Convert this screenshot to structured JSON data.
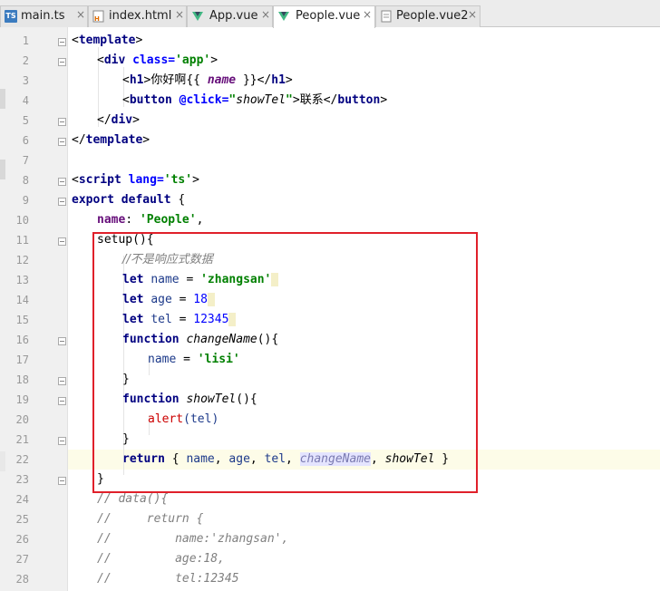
{
  "tabs": [
    {
      "name": "main.ts",
      "icon": "typescript-file-icon",
      "active": false
    },
    {
      "name": "index.html",
      "icon": "html-file-icon",
      "active": false
    },
    {
      "name": "App.vue",
      "icon": "vue-file-icon",
      "active": false
    },
    {
      "name": "People.vue",
      "icon": "vue-file-icon",
      "active": true
    },
    {
      "name": "People.vue2",
      "icon": "text-file-icon",
      "active": false
    }
  ],
  "tab_close_glyph": "×",
  "line_numbers": [
    "1",
    "2",
    "3",
    "4",
    "5",
    "6",
    "7",
    "8",
    "9",
    "10",
    "11",
    "12",
    "13",
    "14",
    "15",
    "16",
    "17",
    "18",
    "19",
    "20",
    "21",
    "22",
    "23",
    "24",
    "25",
    "26",
    "27",
    "28"
  ],
  "code": {
    "l1": {
      "tag": "template"
    },
    "l2": {
      "tag": "div",
      "attr": "class",
      "val": "'app'"
    },
    "l3": {
      "tag": "h1",
      "text_cn": "你好啊",
      "interp": "name"
    },
    "l4": {
      "tag": "button",
      "event": "@click",
      "handler": "showTel",
      "label_cn": "联系"
    },
    "l5": {
      "tag": "div"
    },
    "l6": {
      "tag": "template"
    },
    "l8": {
      "tag": "script",
      "attr": "lang",
      "val": "'ts'"
    },
    "l9": {
      "kw1": "export",
      "kw2": "default",
      "brace": "{"
    },
    "l10": {
      "key": "name",
      "val": "'People'"
    },
    "l11": {
      "text": "setup(){"
    },
    "l12": {
      "comment": "//不是响应式数据"
    },
    "l13": {
      "kw": "let",
      "var": "name",
      "val": "'zhangsan'"
    },
    "l14": {
      "kw": "let",
      "var": "age",
      "val": "18"
    },
    "l15": {
      "kw": "let",
      "var": "tel",
      "val": "12345"
    },
    "l16": {
      "kw": "function",
      "fn": "changeName",
      "tail": "(){"
    },
    "l17": {
      "var": "name",
      "val": "'lisi'"
    },
    "l18": {
      "text": "}"
    },
    "l19": {
      "kw": "function",
      "fn": "showTel",
      "tail": "(){"
    },
    "l20": {
      "fn": "alert",
      "arg": "(tel)"
    },
    "l21": {
      "text": "}"
    },
    "l22": {
      "kw": "return",
      "items": [
        "name",
        "age",
        "tel",
        "changeName",
        "showTel"
      ]
    },
    "l23": {
      "text": "}"
    },
    "l24": {
      "comment": "// data(){"
    },
    "l25": {
      "comment": "//     return {"
    },
    "l26": {
      "comment": "//         name:'zhangsan',"
    },
    "l27": {
      "comment": "//         age:18,"
    },
    "l28": {
      "comment": "//         tel:12345"
    }
  },
  "colors": {
    "highlight_box": "#e0202a",
    "current_line": "#fdfce8",
    "keyword": "#000080",
    "string": "#008000"
  }
}
